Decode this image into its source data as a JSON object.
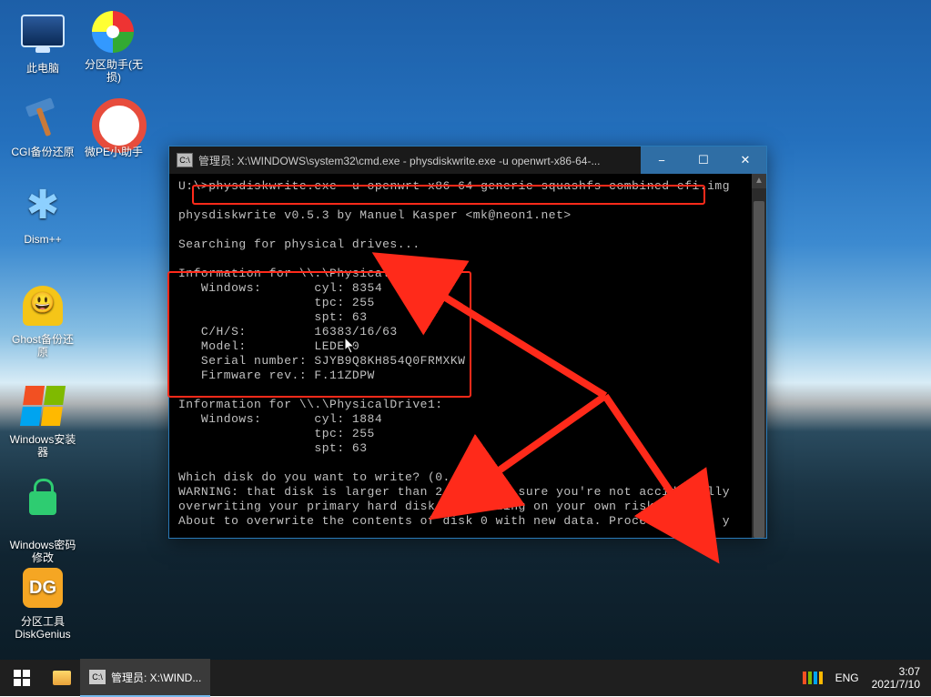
{
  "desktop_icons": [
    {
      "id": "pc",
      "label": "此电脑"
    },
    {
      "id": "partassist",
      "label": "分区助手(无损)"
    },
    {
      "id": "cgi",
      "label": "CGI备份还原"
    },
    {
      "id": "wepe",
      "label": "微PE小助手"
    },
    {
      "id": "dism",
      "label": "Dism++"
    },
    {
      "id": "ghost",
      "label": "Ghost备份还原"
    },
    {
      "id": "wininst",
      "label": "Windows安装器"
    },
    {
      "id": "winpass",
      "label": "Windows密码修改"
    },
    {
      "id": "diskgenius",
      "label": "分区工具DiskGenius"
    }
  ],
  "window": {
    "title": "管理员: X:\\WINDOWS\\system32\\cmd.exe - physdiskwrite.exe  -u openwrt-x86-64-...",
    "minimize_icon": "−",
    "maximize_icon": "☐",
    "close_icon": "✕"
  },
  "terminal": {
    "prompt_prefix": "U:\\>",
    "command": "physdiskwrite.exe -u openwrt-x86-64-generic-squashfs-combined-efi.img",
    "blank1": "",
    "version_line": "physdiskwrite v0.5.3 by Manuel Kasper <mk@neon1.net>",
    "blank2": "",
    "searching": "Searching for physical drives...",
    "blank3": "",
    "drive0_header": "Information for \\\\.\\PhysicalDrive0:",
    "d0_win": "   Windows:       cyl: 8354",
    "d0_tpc": "                  tpc: 255",
    "d0_spt": "                  spt: 63",
    "d0_chs": "   C/H/S:         16383/16/63",
    "d0_model": "   Model:         LEDE-0",
    "d0_serial": "   Serial number: SJYB9Q8KH854Q0FRMXKW",
    "d0_fw": "   Firmware rev.: F.11ZDPW",
    "blank4": "",
    "drive1_header": "Information for \\\\.\\PhysicalDrive1:",
    "d1_win": "   Windows:       cyl: 1884",
    "d1_tpc": "                  tpc: 255",
    "d1_spt": "                  spt: 63",
    "blank5": "",
    "which_prefix": "Which disk do you want to write? (0..1) ",
    "which_answer": "0",
    "warn1": "WARNING: that disk is larger than 2 GB! Make sure you're not accidentally",
    "warn2": "overwriting your primary hard disk! Proceeding on your own risk...",
    "about_prefix": "About to overwrite the contents of disk 0 with new data. Proceed? (y/n) ",
    "about_answer": "y"
  },
  "taskbar": {
    "explorer_tooltip": "文件资源管理器",
    "active_task": "管理员: X:\\WIND...",
    "ime_lang": "ENG",
    "time": "3:07",
    "date": "2021/7/10"
  }
}
